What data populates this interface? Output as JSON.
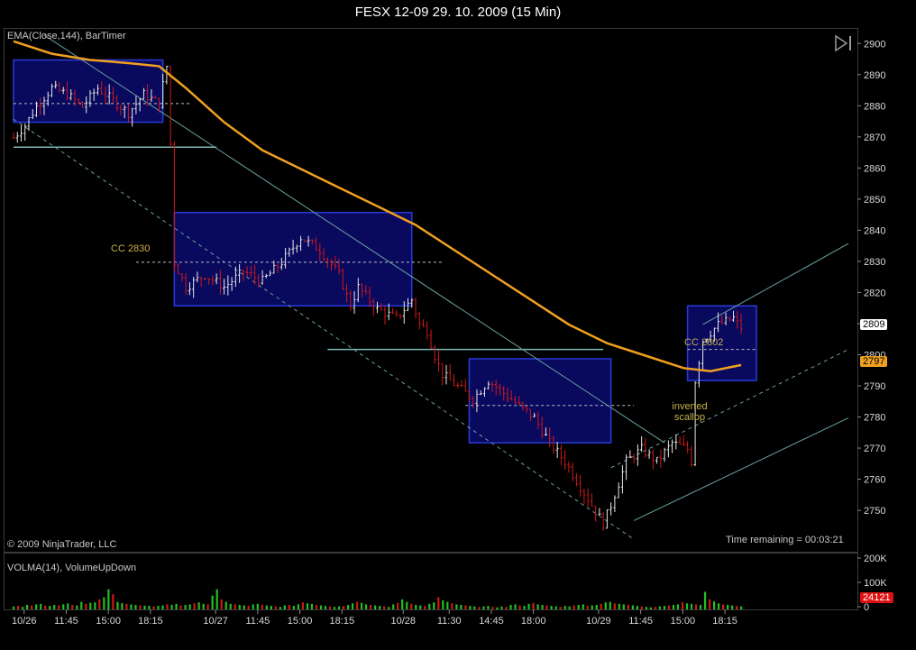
{
  "window": {
    "title": "FESX 12-09  29. 10. 2009 (15 Min)"
  },
  "price_panel": {
    "indicator_label": "EMA(Close,144), BarTimer",
    "copyright": "© 2009 NinjaTrader, LLC",
    "time_remaining": "Time remaining = 00:03:21",
    "cc_2830_label": "CC 2830",
    "cc_2802_label": "CC 2802",
    "scallop_line1": "inverted",
    "scallop_line2": "scallop",
    "last_price": "2809",
    "ema_value": "2797",
    "last_price_color": "#ffffff",
    "ema_value_color": "#f0a020"
  },
  "volume_panel": {
    "indicator_label": "VOLMA(14), VolumeUpDown",
    "last_volume": "24121",
    "last_volume_color": "#e01010"
  },
  "chart_data": {
    "type": "candlestick",
    "instrument": "FESX 12-09",
    "timeframe": "15 Min",
    "y_axis": {
      "ylim": [
        2737,
        2905
      ],
      "ticks": [
        2750,
        2760,
        2770,
        2780,
        2790,
        2800,
        2810,
        2820,
        2830,
        2840,
        2850,
        2860,
        2870,
        2880,
        2890,
        2900
      ]
    },
    "volume_axis": {
      "ticks": [
        "200K",
        "100K",
        "0"
      ]
    },
    "x_tick_labels": [
      "10/26",
      "11:45",
      "15:00",
      "18:15",
      "10/27",
      "11:45",
      "15:00",
      "18:15",
      "10/28",
      "11:30",
      "14:45",
      "18:00",
      "10/29",
      "11:45",
      "15:00",
      "18:15"
    ],
    "price_path": [
      [
        0,
        2870
      ],
      [
        3,
        2874
      ],
      [
        6,
        2880
      ],
      [
        10,
        2886
      ],
      [
        14,
        2884
      ],
      [
        18,
        2880
      ],
      [
        22,
        2886
      ],
      [
        26,
        2882
      ],
      [
        30,
        2878
      ],
      [
        34,
        2884
      ],
      [
        38,
        2881
      ],
      [
        40,
        2893
      ],
      [
        41,
        2868
      ],
      [
        42,
        2830
      ],
      [
        45,
        2822
      ],
      [
        50,
        2826
      ],
      [
        55,
        2822
      ],
      [
        60,
        2827
      ],
      [
        65,
        2824
      ],
      [
        70,
        2830
      ],
      [
        75,
        2838
      ],
      [
        80,
        2834
      ],
      [
        85,
        2826
      ],
      [
        88,
        2816
      ],
      [
        90,
        2822
      ],
      [
        95,
        2815
      ],
      [
        100,
        2812
      ],
      [
        104,
        2818
      ],
      [
        106,
        2810
      ],
      [
        108,
        2808
      ],
      [
        110,
        2800
      ],
      [
        112,
        2794
      ],
      [
        116,
        2790
      ],
      [
        120,
        2786
      ],
      [
        124,
        2792
      ],
      [
        128,
        2788
      ],
      [
        132,
        2784
      ],
      [
        136,
        2780
      ],
      [
        140,
        2772
      ],
      [
        144,
        2766
      ],
      [
        148,
        2758
      ],
      [
        152,
        2750
      ],
      [
        154,
        2746
      ],
      [
        156,
        2752
      ],
      [
        160,
        2766
      ],
      [
        164,
        2770
      ],
      [
        168,
        2766
      ],
      [
        172,
        2772
      ],
      [
        176,
        2770
      ],
      [
        177,
        2766
      ],
      [
        178,
        2792
      ],
      [
        180,
        2805
      ],
      [
        184,
        2810
      ],
      [
        188,
        2812
      ],
      [
        190,
        2809
      ]
    ],
    "ema_144": [
      [
        0,
        2901
      ],
      [
        10,
        2897
      ],
      [
        20,
        2895
      ],
      [
        30,
        2894
      ],
      [
        38,
        2893
      ],
      [
        45,
        2886
      ],
      [
        55,
        2875
      ],
      [
        65,
        2866
      ],
      [
        75,
        2860
      ],
      [
        85,
        2854
      ],
      [
        95,
        2848
      ],
      [
        105,
        2842
      ],
      [
        115,
        2834
      ],
      [
        125,
        2826
      ],
      [
        135,
        2818
      ],
      [
        145,
        2810
      ],
      [
        155,
        2804
      ],
      [
        165,
        2800
      ],
      [
        175,
        2796
      ],
      [
        182,
        2795
      ],
      [
        190,
        2797
      ]
    ],
    "consolidation_boxes": [
      {
        "x0": 0,
        "x1": 39,
        "y0": 2875,
        "y1": 2895
      },
      {
        "x0": 42,
        "x1": 104,
        "y0": 2816,
        "y1": 2846
      },
      {
        "x0": 119,
        "x1": 156,
        "y0": 2772,
        "y1": 2799
      },
      {
        "x0": 176,
        "x1": 194,
        "y0": 2792,
        "y1": 2816
      }
    ],
    "horizontal_levels": [
      {
        "x0": 0,
        "x1": 46,
        "y": 2881,
        "style": "dashed"
      },
      {
        "x0": 32,
        "x1": 112,
        "y": 2830,
        "style": "dashed"
      },
      {
        "x0": 118,
        "x1": 162,
        "y": 2784,
        "style": "dashed"
      },
      {
        "x0": 176,
        "x1": 194,
        "y": 2802,
        "style": "dashed"
      },
      {
        "x0": 0,
        "x1": 53,
        "y": 2867,
        "style": "solid"
      },
      {
        "x0": 82,
        "x1": 154,
        "y": 2802,
        "style": "solid"
      }
    ],
    "trend_lines": [
      {
        "x0": 8,
        "y0": 2903,
        "x1": 170,
        "y1": 2772,
        "style": "solid"
      },
      {
        "x0": 0,
        "x1": 162,
        "y0": 2876,
        "y1": 2741,
        "style": "dashed"
      },
      {
        "x0": 162,
        "y0": 2747,
        "x1": 218,
        "y1": 2780,
        "style": "solid"
      },
      {
        "x0": 156,
        "y0": 2764,
        "x1": 218,
        "y1": 2802,
        "style": "dashed"
      },
      {
        "x0": 180,
        "y0": 2810,
        "x1": 218,
        "y1": 2836,
        "style": "solid"
      }
    ],
    "volume": [
      12,
      14,
      10,
      18,
      16,
      20,
      22,
      15,
      14,
      18,
      16,
      20,
      24,
      18,
      16,
      30,
      22,
      26,
      28,
      40,
      48,
      80,
      60,
      30,
      25,
      22,
      20,
      18,
      16,
      15,
      14,
      12,
      14,
      16,
      20,
      18,
      22,
      16,
      18,
      20,
      24,
      28,
      22,
      20,
      55,
      80,
      40,
      30,
      22,
      20,
      18,
      16,
      14,
      20,
      22,
      18,
      16,
      14,
      12,
      10,
      16,
      18,
      14,
      20,
      28,
      24,
      22,
      18,
      16,
      14,
      12,
      10,
      12,
      14,
      18,
      24,
      30,
      26,
      20,
      18,
      16,
      14,
      12,
      10,
      20,
      26,
      40,
      30,
      22,
      18,
      16,
      14,
      22,
      28,
      48,
      36,
      30,
      24,
      20,
      18,
      16,
      14,
      12,
      10,
      12,
      14,
      10,
      8,
      12,
      10,
      18,
      20,
      16,
      14,
      22,
      26,
      20,
      18,
      16,
      14,
      12,
      10,
      14,
      12,
      16,
      18,
      20,
      14,
      16,
      18,
      22,
      28,
      30,
      24,
      22,
      20,
      18,
      16,
      14,
      12,
      10,
      8,
      10,
      12,
      14,
      16,
      18,
      20,
      28,
      24,
      22,
      20,
      18,
      70,
      40,
      32,
      24,
      20,
      18,
      16,
      14,
      12
    ],
    "volume_colors_note": "up=green down=red"
  }
}
